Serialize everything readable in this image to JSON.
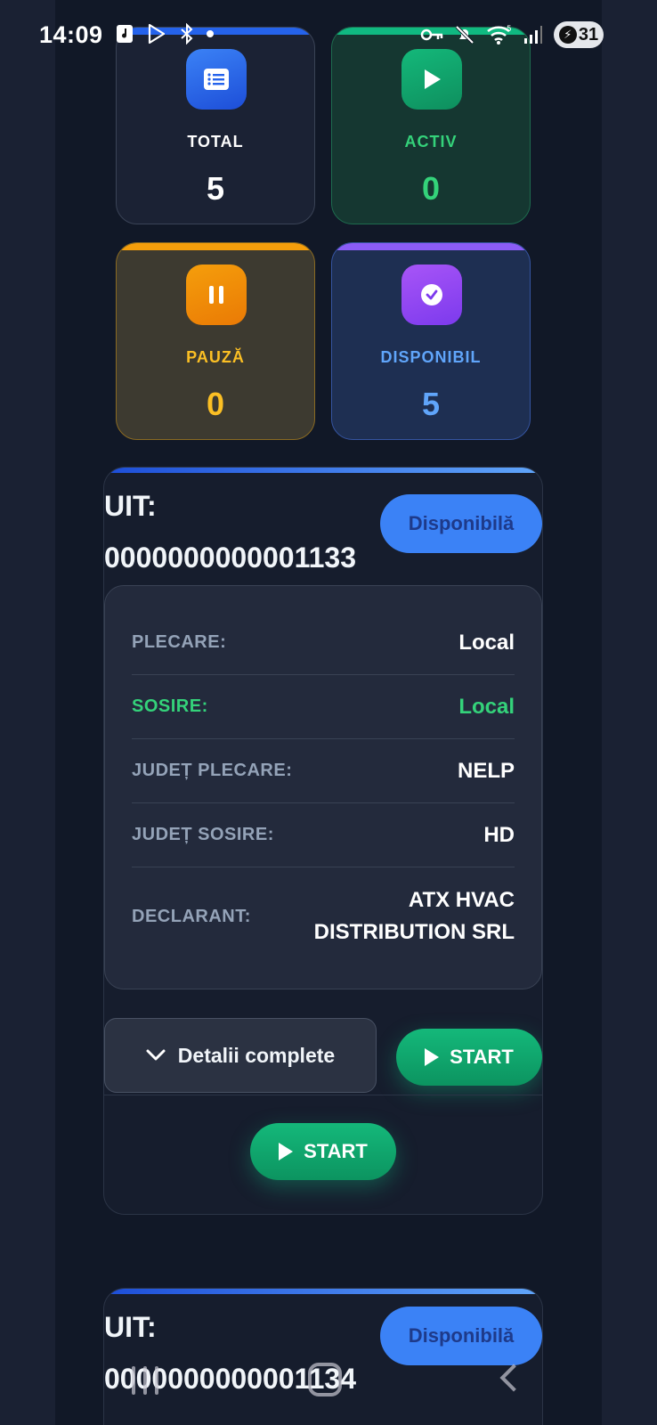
{
  "status_bar": {
    "time": "14:09",
    "battery": "31",
    "left_icons": [
      "music-icon",
      "play-store-icon",
      "bluetooth-icon",
      "dot-icon"
    ],
    "right_icons": [
      "key-icon",
      "mute-icon",
      "wifi-icon",
      "signal-icon",
      "battery-icon"
    ]
  },
  "stats": {
    "total": {
      "label": "TOTAL",
      "value": "5",
      "icon": "list-icon"
    },
    "activ": {
      "label": "ACTIV",
      "value": "0",
      "icon": "play-icon"
    },
    "pauza": {
      "label": "PAUZĂ",
      "value": "0",
      "icon": "pause-icon"
    },
    "disponibil": {
      "label": "DISPONIBIL",
      "value": "5",
      "icon": "check-circle-icon"
    }
  },
  "cards": [
    {
      "uit_label": "UIT:",
      "uit_number": "0000000000001133",
      "status": "Disponibilă",
      "rows": [
        {
          "key": "PLECARE:",
          "value": "Local"
        },
        {
          "key": "SOSIRE:",
          "value": "Local"
        },
        {
          "key": "JUDEȚ PLECARE:",
          "value": "NELP"
        },
        {
          "key": "JUDEȚ SOSIRE:",
          "value": "HD"
        },
        {
          "key": "DECLARANT:",
          "value_line1": "ATX HVAC",
          "value_line2": "DISTRIBUTION SRL"
        }
      ],
      "details_button": "Detalii complete",
      "start_button": "START",
      "start_button_2": "START"
    },
    {
      "uit_label": "UIT:",
      "uit_number": "0000000000001134",
      "status": "Disponibilă"
    }
  ],
  "colors": {
    "background": "#111827",
    "accent_blue": "#3b82f6",
    "accent_green": "#10b981",
    "accent_orange": "#f59e0b",
    "accent_purple": "#8b5cf6"
  }
}
